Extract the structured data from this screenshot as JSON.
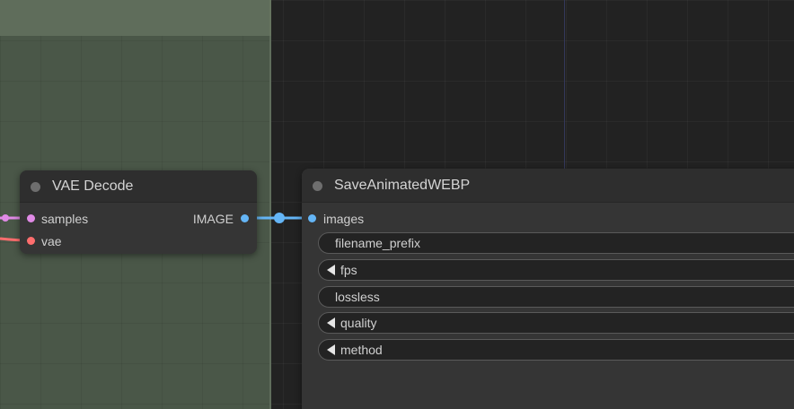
{
  "colors": {
    "samples_link": "#e08ae6",
    "vae_link": "#ff6e6e",
    "image_link": "#64b5f6"
  },
  "vae_decode": {
    "title": "VAE Decode",
    "inputs": [
      "samples",
      "vae"
    ],
    "output": "IMAGE"
  },
  "save_webp": {
    "title": "SaveAnimatedWEBP",
    "input": "images",
    "widgets": [
      {
        "label": "filename_prefix",
        "has_arrow": false
      },
      {
        "label": "fps",
        "has_arrow": true
      },
      {
        "label": "lossless",
        "has_arrow": false
      },
      {
        "label": "quality",
        "has_arrow": true
      },
      {
        "label": "method",
        "has_arrow": true
      }
    ]
  }
}
